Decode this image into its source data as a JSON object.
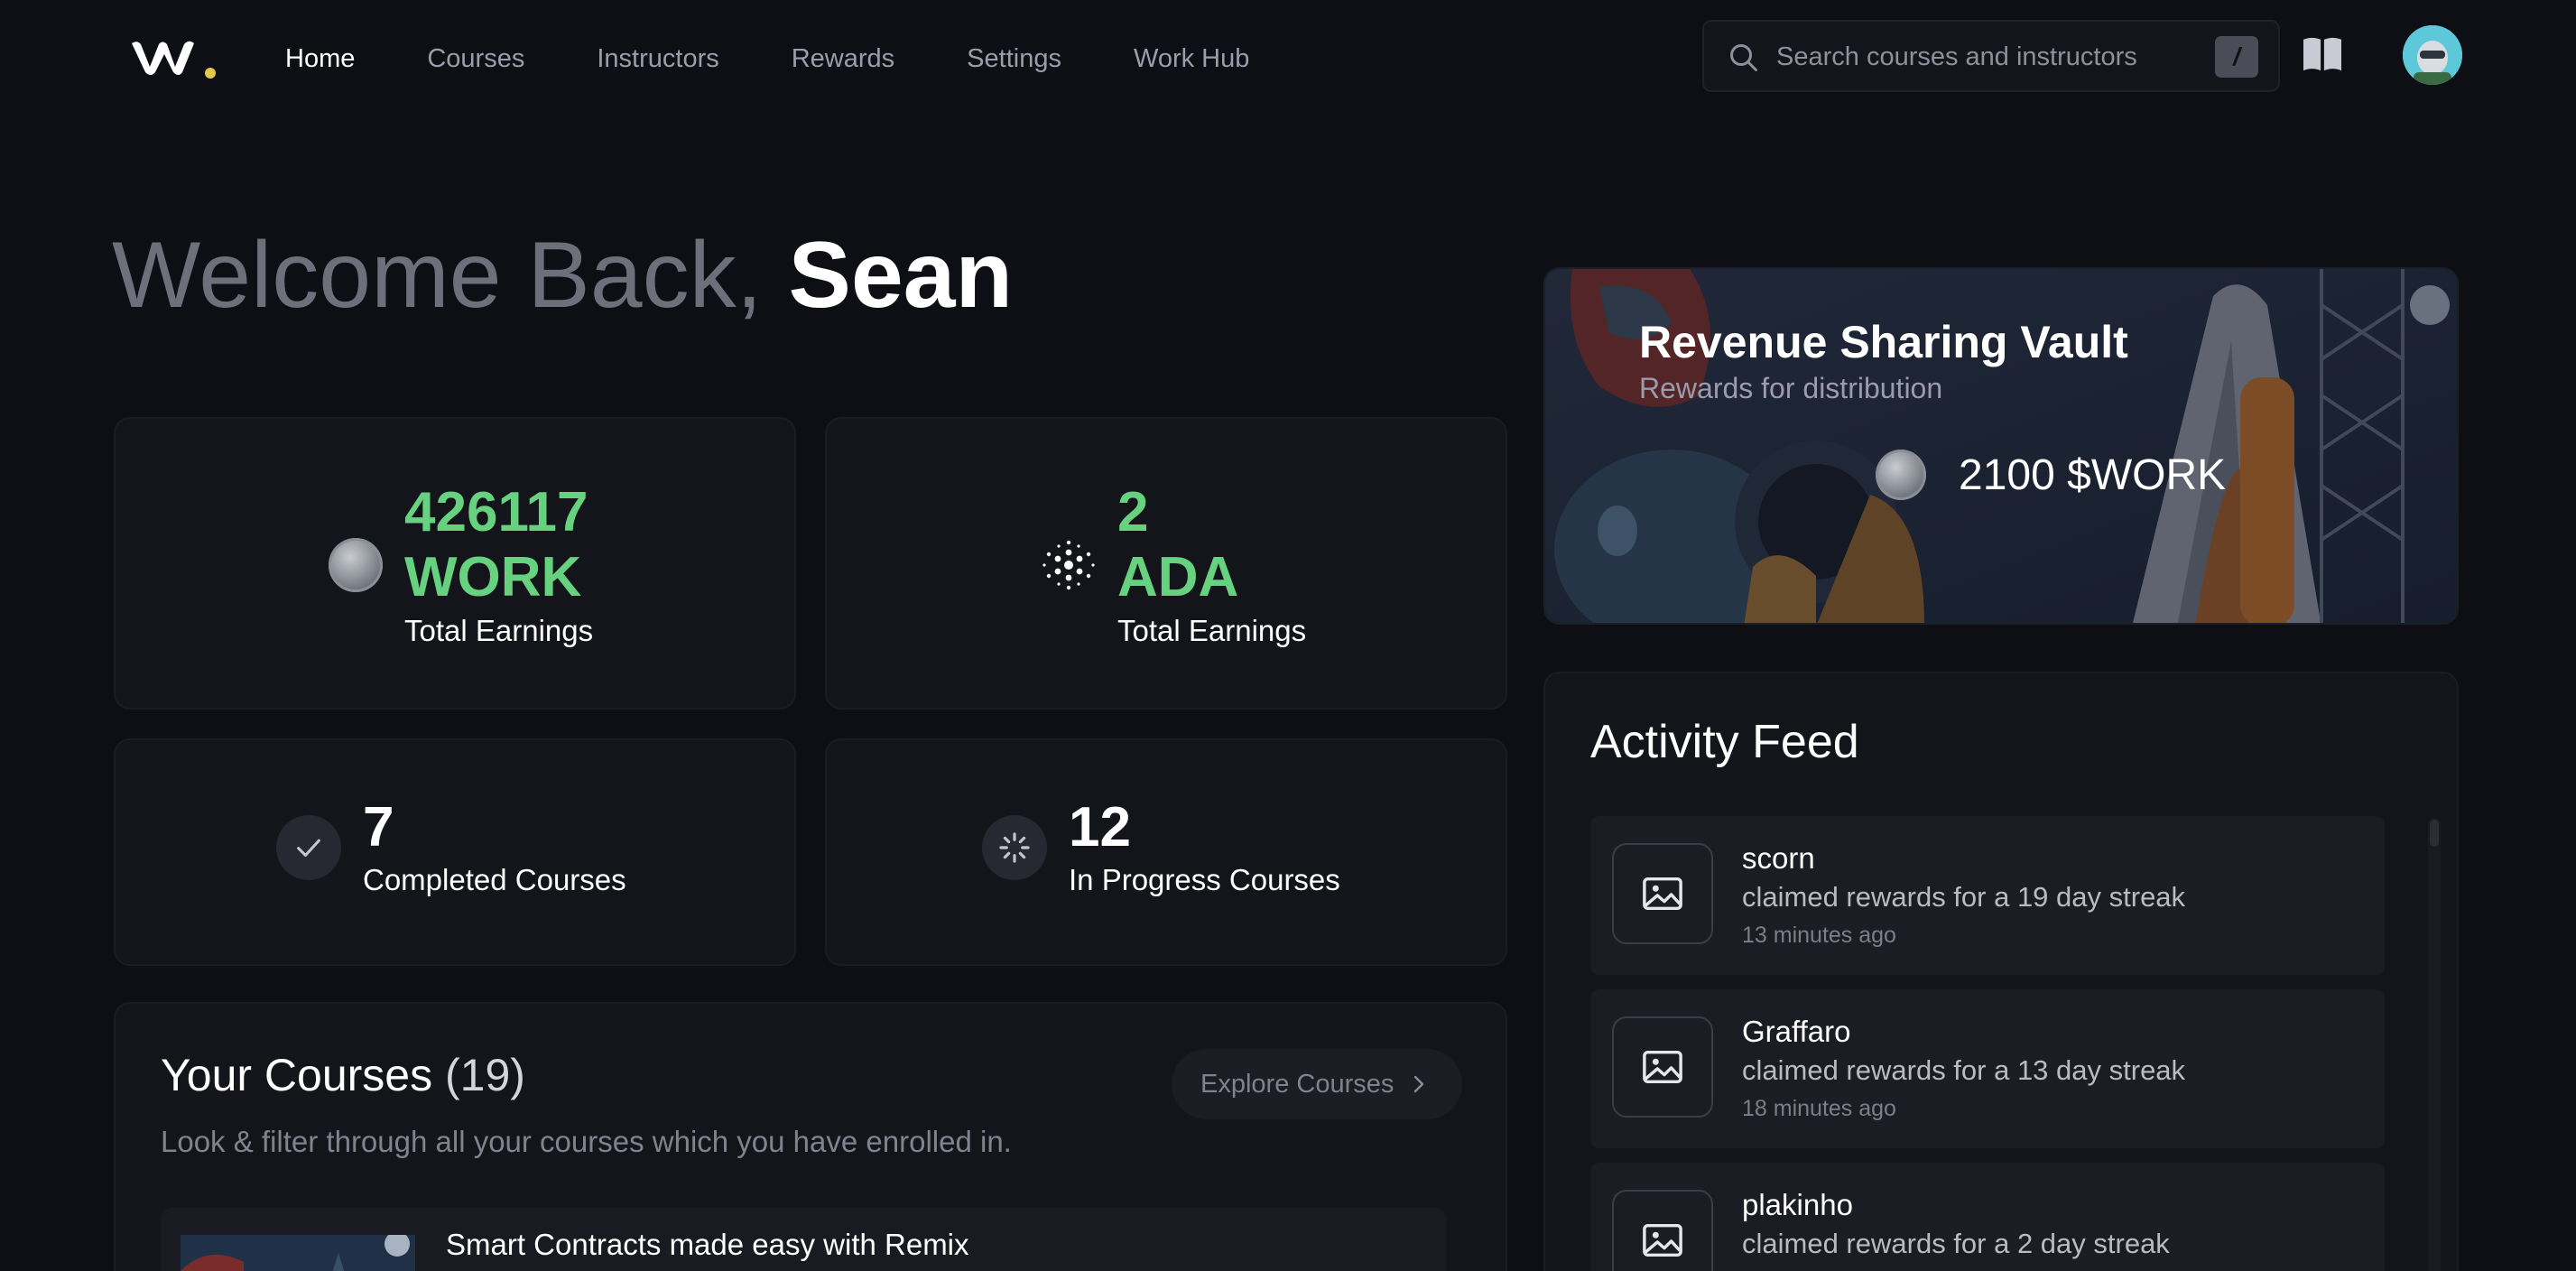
{
  "nav": {
    "links": [
      "Home",
      "Courses",
      "Instructors",
      "Rewards",
      "Settings",
      "Work Hub"
    ],
    "active": "Home"
  },
  "search": {
    "placeholder": "Search courses and instructors",
    "shortcut": "/"
  },
  "greeting": {
    "prefix": "Welcome Back,",
    "name": "Sean"
  },
  "stats": {
    "work": {
      "amount": "426117",
      "unit": "WORK",
      "label": "Total Earnings",
      "icon": "work-coin-icon"
    },
    "ada": {
      "amount": "2",
      "unit": "ADA",
      "label": "Total Earnings",
      "icon": "cardano-icon"
    },
    "completed": {
      "count": "7",
      "label": "Completed Courses",
      "icon": "check-icon"
    },
    "in_progress": {
      "count": "12",
      "label": "In Progress Courses",
      "icon": "loading-spinner-icon"
    }
  },
  "courses": {
    "title": "Your Courses",
    "count": "(19)",
    "subtitle": "Look & filter through all your courses which you have enrolled in.",
    "explore_label": "Explore Courses",
    "items": [
      {
        "title": "Smart Contracts made easy with Remix"
      }
    ]
  },
  "vault": {
    "title": "Revenue Sharing Vault",
    "subtitle": "Rewards for distribution",
    "amount": "2100 $WORK"
  },
  "activity": {
    "title": "Activity Feed",
    "items": [
      {
        "user": "scorn",
        "desc": "claimed rewards for a 19 day streak",
        "time": "13 minutes ago"
      },
      {
        "user": "Graffaro",
        "desc": "claimed rewards for a 13 day streak",
        "time": "18 minutes ago"
      },
      {
        "user": "plakinho",
        "desc": "claimed rewards for a 2 day streak",
        "time": ""
      }
    ]
  },
  "colors": {
    "background": "#0e0f14",
    "card": "#14151b",
    "accent_green": "#66d17e",
    "logo_dot": "#e3c84b"
  }
}
